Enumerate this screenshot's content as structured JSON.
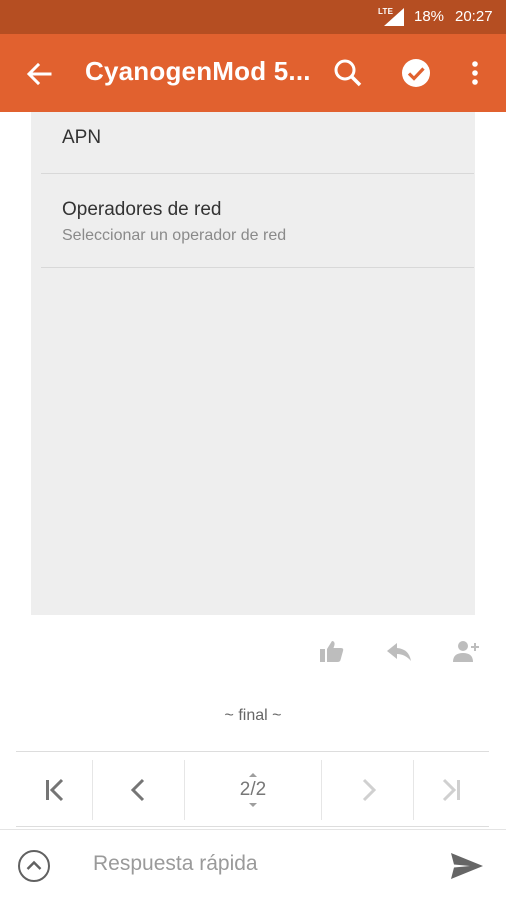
{
  "status_bar": {
    "network": "LTE",
    "battery": "18%",
    "time": "20:27",
    "icons": [
      "signal-icon"
    ]
  },
  "app_bar": {
    "title": "CyanogenMod 5...",
    "icons": [
      "back-arrow-icon",
      "search-icon",
      "check-circle-icon",
      "more-vert-icon"
    ],
    "color": "#e1612f"
  },
  "settings": {
    "items": [
      {
        "title": "APN",
        "subtitle": ""
      },
      {
        "title": "Operadores de red",
        "subtitle": "Seleccionar un operador de red"
      }
    ]
  },
  "actions": {
    "icons": [
      "thumb-up-icon",
      "reply-icon",
      "add-user-icon"
    ]
  },
  "footer": {
    "end_marker": "~ final ~"
  },
  "pager": {
    "page_label": "2/2",
    "icons": [
      "first-page-icon",
      "previous-icon",
      "next-icon",
      "last-page-icon"
    ]
  },
  "reply": {
    "placeholder": "Respuesta rápida",
    "icons": [
      "expand-up-icon",
      "send-icon"
    ]
  },
  "colors": {
    "status_bar": "#b54e22",
    "app_bar": "#e1612f",
    "panel": "#eeeeee"
  }
}
